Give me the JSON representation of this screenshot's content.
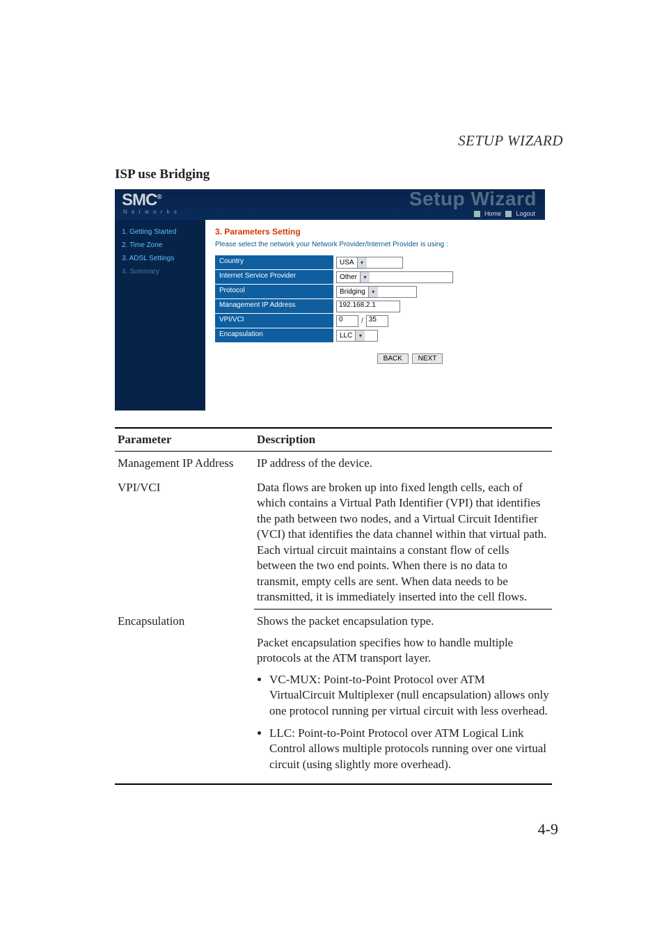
{
  "page_header": "SETUP WIZARD",
  "section_heading": "ISP use Bridging",
  "page_number": "4-9",
  "screenshot": {
    "logo_main": "SMC",
    "logo_sup": "®",
    "logo_sub": "N e t w o r k s",
    "title_ghost": "Setup Wizard",
    "top_links": {
      "home": "Home",
      "logout": "Logout"
    },
    "sidebar": [
      "1. Getting Started",
      "2. Time Zone",
      "3. ADSL Settings",
      "4. Summary"
    ],
    "panel_heading": "3. Parameters Setting",
    "panel_hint": "Please select the network your Network Provider/Internet Provider is using :",
    "rows": {
      "country_label": "Country",
      "country_value": "USA",
      "isp_label": "Internet Service Provider",
      "isp_value": "Other",
      "protocol_label": "Protocol",
      "protocol_value": "Bridging",
      "mgmt_label": "Management IP Address",
      "mgmt_value": "192.168.2.1",
      "vpivci_label": "VPI/VCI",
      "vpi_value": "0",
      "vci_value": "35",
      "encap_label": "Encapsulation",
      "encap_value": "LLC"
    },
    "buttons": {
      "back": "BACK",
      "next": "NEXT"
    }
  },
  "table": {
    "head": {
      "col1": "Parameter",
      "col2": "Description"
    },
    "row_mgmt": {
      "param": "Management IP Address",
      "desc": "IP address of the device."
    },
    "row_vpivci": {
      "param": "VPI/VCI",
      "desc": "Data flows are broken up into fixed length cells, each of which contains a Virtual Path Identifier (VPI) that identifies the path between two nodes, and a Virtual Circuit Identifier (VCI) that identifies the data channel within that virtual path. Each virtual circuit maintains a constant flow of cells between the two end points. When there is no data to transmit, empty cells are sent. When data needs to be transmitted, it is immediately inserted into the cell flows."
    },
    "row_encap": {
      "param": "Encapsulation",
      "p1": "Shows the packet encapsulation type.",
      "p2": "Packet encapsulation specifies how to handle multiple protocols at the ATM transport layer.",
      "li1": "VC-MUX: Point-to-Point Protocol over ATM VirtualCircuit Multiplexer (null encapsulation) allows only one protocol running per virtual circuit with less overhead.",
      "li2": "LLC: Point-to-Point Protocol over ATM Logical Link Control allows multiple protocols running over one virtual circuit (using slightly more overhead)."
    }
  }
}
